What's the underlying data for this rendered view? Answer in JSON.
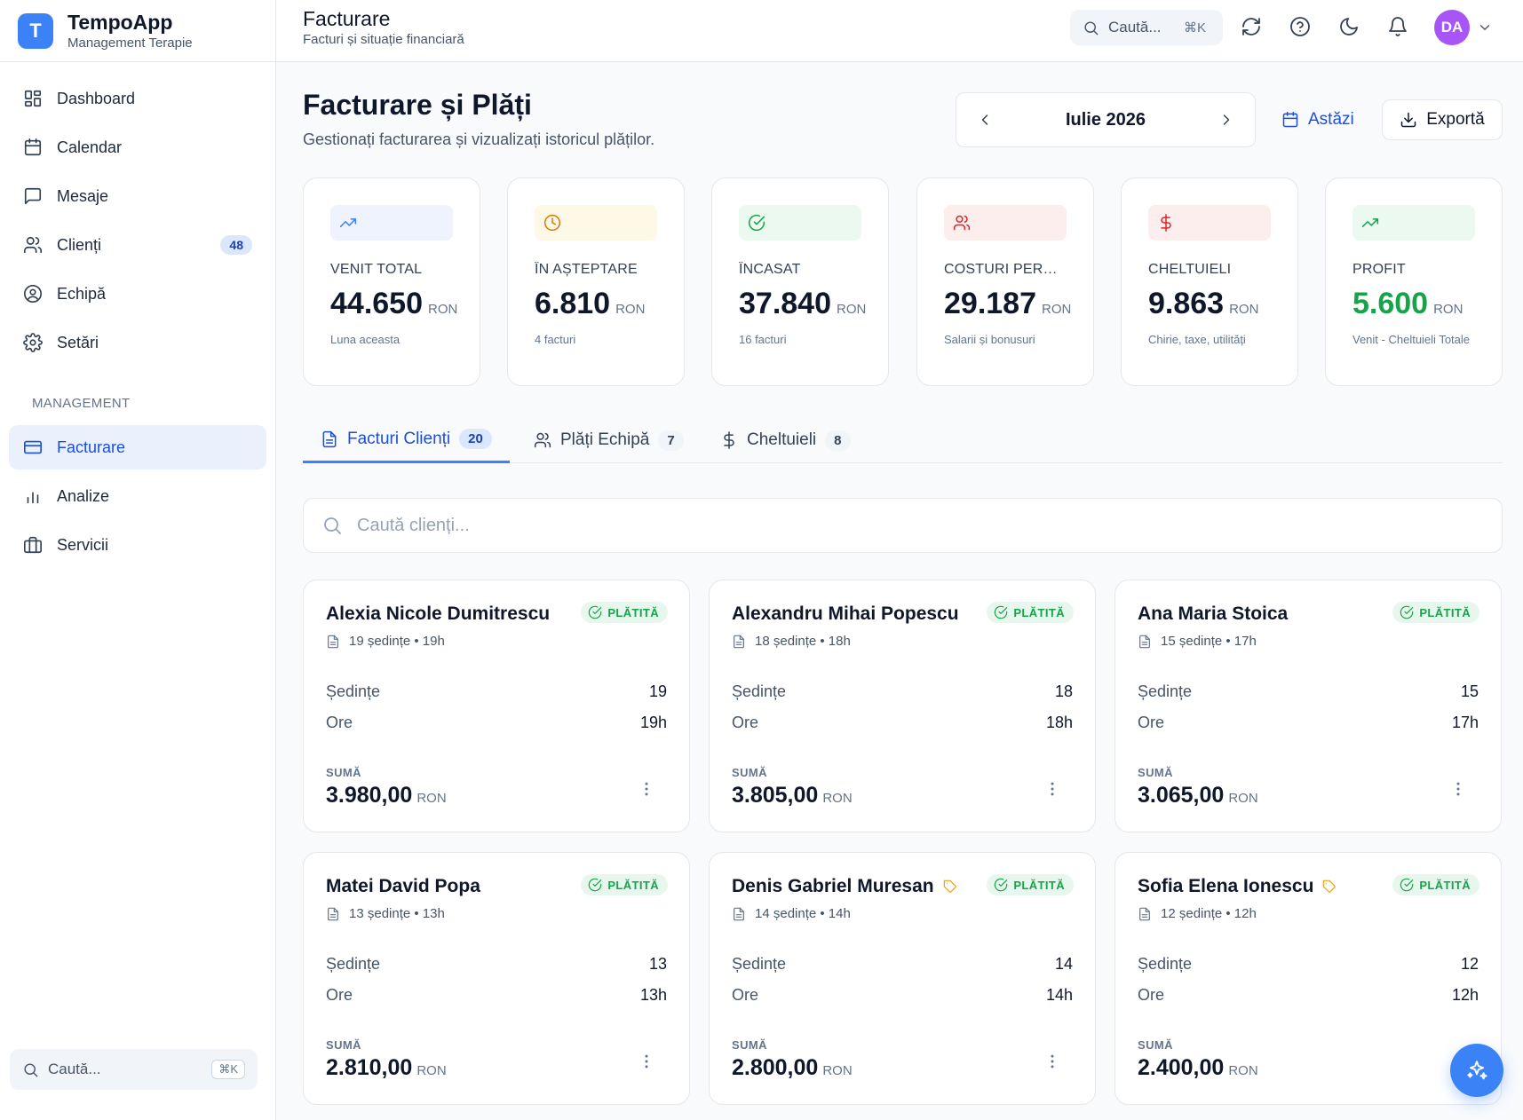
{
  "brand": {
    "logo_letter": "T",
    "title": "TempoApp",
    "subtitle": "Management Terapie"
  },
  "sidebar": {
    "items": [
      {
        "label": "Dashboard",
        "icon": "grid-icon"
      },
      {
        "label": "Calendar",
        "icon": "calendar-icon"
      },
      {
        "label": "Mesaje",
        "icon": "message-icon"
      },
      {
        "label": "Clienți",
        "icon": "users-icon",
        "badge": "48"
      },
      {
        "label": "Echipă",
        "icon": "user-circle-icon"
      },
      {
        "label": "Setări",
        "icon": "gear-icon"
      }
    ],
    "section_label": "MANAGEMENT",
    "management_items": [
      {
        "label": "Facturare",
        "icon": "credit-card-icon",
        "active": true
      },
      {
        "label": "Analize",
        "icon": "bar-chart-icon"
      },
      {
        "label": "Servicii",
        "icon": "briefcase-icon"
      }
    ],
    "search": {
      "placeholder": "Caută...",
      "shortcut": "⌘K"
    }
  },
  "topbar": {
    "title": "Facturare",
    "subtitle": "Facturi și situație financiară",
    "search": {
      "placeholder": "Caută...",
      "shortcut": "⌘K"
    },
    "avatar": "DA"
  },
  "page": {
    "title": "Facturare și Plăți",
    "subtitle": "Gestionați facturarea și vizualizați istoricul plăților.",
    "month": "Iulie 2026",
    "today_label": "Astăzi",
    "export_label": "Exportă"
  },
  "stats": [
    {
      "label": "VENIT TOTAL",
      "value": "44.650",
      "currency": "RON",
      "note": "Luna aceasta",
      "icon": "trend-up-icon",
      "color": "#3b82f6",
      "bg": "#eef3fd"
    },
    {
      "label": "ÎN AȘTEPTARE",
      "value": "6.810",
      "currency": "RON",
      "note": "4 facturi",
      "icon": "clock-icon",
      "color": "#d97706",
      "bg": "#fef8e7"
    },
    {
      "label": "ÎNCASAT",
      "value": "37.840",
      "currency": "RON",
      "note": "16 facturi",
      "icon": "check-circle-icon",
      "color": "#16a34a",
      "bg": "#ecf9f0"
    },
    {
      "label": "COSTURI PERSONAL",
      "value": "29.187",
      "currency": "RON",
      "note": "Salarii și bonusuri",
      "icon": "users-icon",
      "color": "#dc2626",
      "bg": "#fdeeee"
    },
    {
      "label": "CHELTUIELI",
      "value": "9.863",
      "currency": "RON",
      "note": "Chirie, taxe, utilități",
      "icon": "dollar-icon",
      "color": "#dc2626",
      "bg": "#fdeeee"
    },
    {
      "label": "PROFIT",
      "value": "5.600",
      "currency": "RON",
      "note": "Venit - Cheltuieli Totale",
      "icon": "trend-up-icon",
      "color": "#16a34a",
      "bg": "#ecf9f0",
      "value_color": "#16a34a"
    }
  ],
  "tabs": [
    {
      "label": "Facturi Clienți",
      "count": "20",
      "icon": "document-icon",
      "active": true
    },
    {
      "label": "Plăți Echipă",
      "count": "7",
      "icon": "users-icon"
    },
    {
      "label": "Cheltuieli",
      "count": "8",
      "icon": "dollar-icon"
    }
  ],
  "search": {
    "placeholder": "Caută clienți..."
  },
  "labels": {
    "sessions": "Ședințe",
    "hours": "Ore",
    "sum": "SUMĂ",
    "status": "PLĂTITĂ",
    "currency": "RON"
  },
  "invoices": [
    {
      "name": "Alexia Nicole Dumitrescu",
      "meta": "19 ședințe • 19h",
      "sessions": "19",
      "hours": "19h",
      "sum": "3.980,00",
      "tag": false
    },
    {
      "name": "Alexandru Mihai Popescu",
      "meta": "18 ședințe • 18h",
      "sessions": "18",
      "hours": "18h",
      "sum": "3.805,00",
      "tag": false
    },
    {
      "name": "Ana Maria Stoica",
      "meta": "15 ședințe • 17h",
      "sessions": "15",
      "hours": "17h",
      "sum": "3.065,00",
      "tag": false
    },
    {
      "name": "Matei David Popa",
      "meta": "13 ședințe • 13h",
      "sessions": "13",
      "hours": "13h",
      "sum": "2.810,00",
      "tag": false
    },
    {
      "name": "Denis Gabriel Muresan",
      "meta": "14 ședințe • 14h",
      "sessions": "14",
      "hours": "14h",
      "sum": "2.800,00",
      "tag": true
    },
    {
      "name": "Sofia Elena Ionescu",
      "meta": "12 ședințe • 12h",
      "sessions": "12",
      "hours": "12h",
      "sum": "2.400,00",
      "tag": true
    }
  ]
}
